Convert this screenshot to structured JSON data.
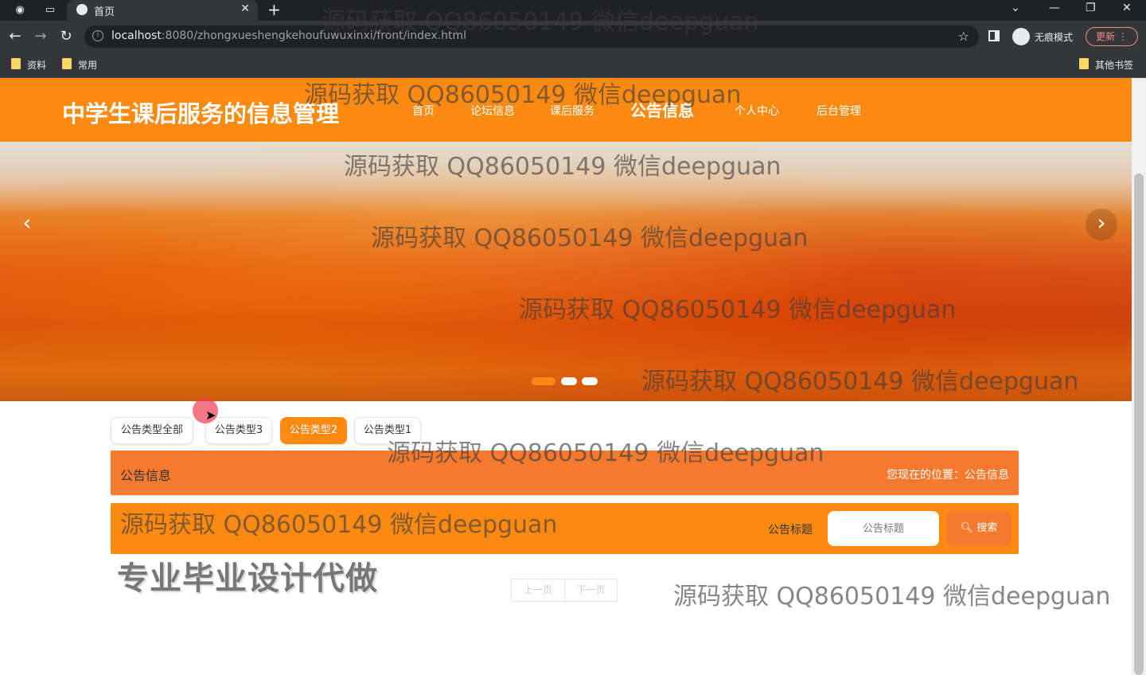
{
  "browser": {
    "tab_title": "首页",
    "tab_close": "✕",
    "new_tab": "+",
    "url_host": "localhost",
    "url_path": ":8080/zhongxueshengkehoufuwuxinxi/front/index.html",
    "incognito_label": "无痕模式",
    "update_label": "更新",
    "bookmarks": [
      "资料",
      "常用"
    ],
    "other_bookmarks": "其他书签"
  },
  "site": {
    "title": "中学生课后服务的信息管理",
    "nav": [
      {
        "label": "首页",
        "active": false
      },
      {
        "label": "论坛信息",
        "active": false
      },
      {
        "label": "课后服务",
        "active": false
      },
      {
        "label": "公告信息",
        "active": true
      },
      {
        "label": "个人中心",
        "active": false
      },
      {
        "label": "后台管理",
        "active": false
      }
    ],
    "brand_color": "#fb8a13"
  },
  "banner": {
    "prev_label": "‹",
    "next_label": "›",
    "slide_count": 3,
    "active_slide": 1
  },
  "filters": [
    {
      "label": "公告类型全部",
      "active": false
    },
    {
      "label": "公告类型3",
      "active": false
    },
    {
      "label": "公告类型2",
      "active": true
    },
    {
      "label": "公告类型1",
      "active": false
    }
  ],
  "section": {
    "title": "公告信息",
    "breadcrumb": "您现在的位置：公告信息"
  },
  "search": {
    "label": "公告标题",
    "placeholder": "公告标题",
    "button_label": "搜索"
  },
  "pager": {
    "prev": "上一页",
    "next": "下一页"
  },
  "promo_text": "专业毕业设计代做",
  "watermark": "源码获取 QQ86050149 微信deepguan"
}
